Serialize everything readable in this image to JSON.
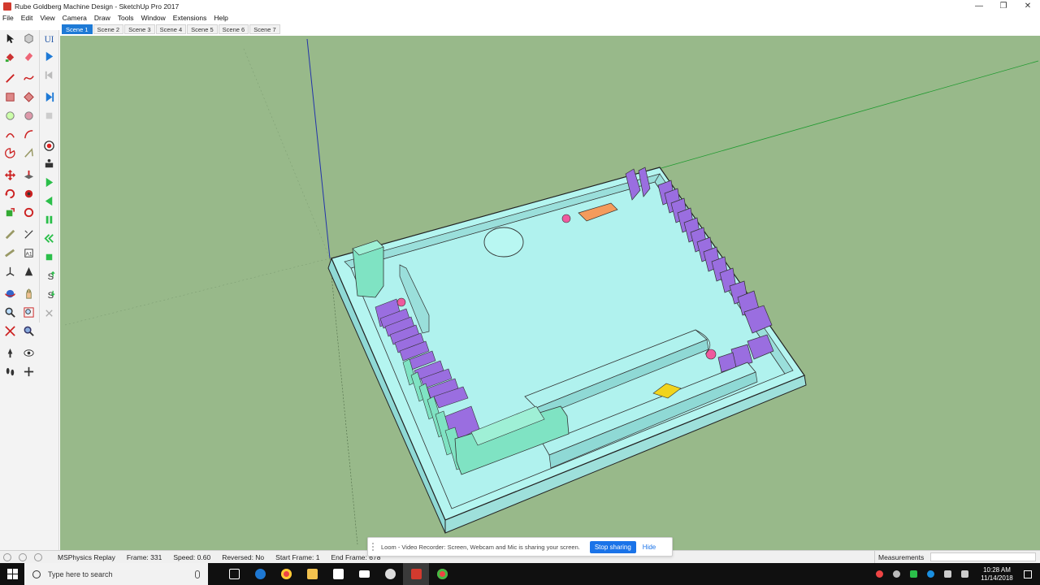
{
  "window": {
    "title": "Rube Goldberg Machine Design - SketchUp Pro 2017",
    "minimize": "—",
    "maximize": "❐",
    "close": "✕"
  },
  "menu": [
    "File",
    "Edit",
    "View",
    "Camera",
    "Draw",
    "Tools",
    "Window",
    "Extensions",
    "Help"
  ],
  "scene_tabs": [
    "Scene 1",
    "Scene 2",
    "Scene 3",
    "Scene 4",
    "Scene 5",
    "Scene 6",
    "Scene 7"
  ],
  "active_scene": "Scene 1",
  "status": {
    "plugin": "MSPhysics Replay",
    "frame": "Frame: 331",
    "speed": "Speed: 0.60",
    "reversed": "Reversed: No",
    "start_frame": "Start Frame: 1",
    "end_frame": "End Frame: 678",
    "measurements_label": "Measurements"
  },
  "loom": {
    "message": "Loom - Video Recorder: Screen, Webcam and Mic is sharing your screen.",
    "stop_label": "Stop sharing",
    "hide_label": "Hide"
  },
  "taskbar": {
    "search_placeholder": "Type here to search",
    "time": "10:28 AM",
    "date": "11/14/2018"
  },
  "colors": {
    "viewport_bg": "#98b98a",
    "board": "#b4f5f0",
    "board_side": "#8fd9d5",
    "dominos": "#9a6ee0",
    "ball": "#ee5a9e",
    "orange_block": "#f49b5c",
    "yellow_wedge": "#f1d41c",
    "green_blocks": "#7fe3c3",
    "active_tab": "#1e7ad6",
    "loom_button": "#1a73e8"
  }
}
